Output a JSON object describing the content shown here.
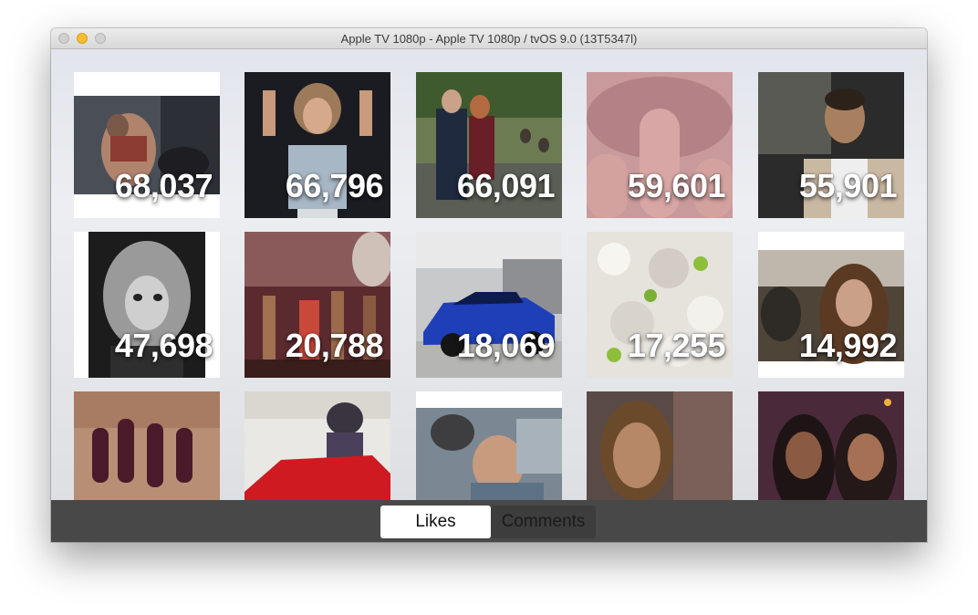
{
  "window": {
    "title": "Apple TV 1080p - Apple TV 1080p / tvOS 9.0 (13T5347l)"
  },
  "tabs": [
    {
      "label": "Likes",
      "selected": true
    },
    {
      "label": "Comments",
      "selected": false
    }
  ],
  "photos": [
    {
      "likes": "68,037",
      "subject": "two women posing on floor"
    },
    {
      "likes": "66,796",
      "subject": "woman laughing in denim vest"
    },
    {
      "likes": "66,091",
      "subject": "couple in park with geese"
    },
    {
      "likes": "59,601",
      "subject": "pink nails and lips"
    },
    {
      "likes": "55,901",
      "subject": "man in car selfie"
    },
    {
      "likes": "47,698",
      "subject": "black and white portrait"
    },
    {
      "likes": "20,788",
      "subject": "concert stage performers"
    },
    {
      "likes": "18,069",
      "subject": "blue sports car"
    },
    {
      "likes": "17,255",
      "subject": "sequined dress detail"
    },
    {
      "likes": "14,992",
      "subject": "woman in crowd"
    },
    {
      "likes": "",
      "subject": "dark manicured nails"
    },
    {
      "likes": "",
      "subject": "man on red sports car"
    },
    {
      "likes": "",
      "subject": "surgeon with headlamp"
    },
    {
      "likes": "",
      "subject": "woman at event"
    },
    {
      "likes": "",
      "subject": "two women at party"
    }
  ]
}
